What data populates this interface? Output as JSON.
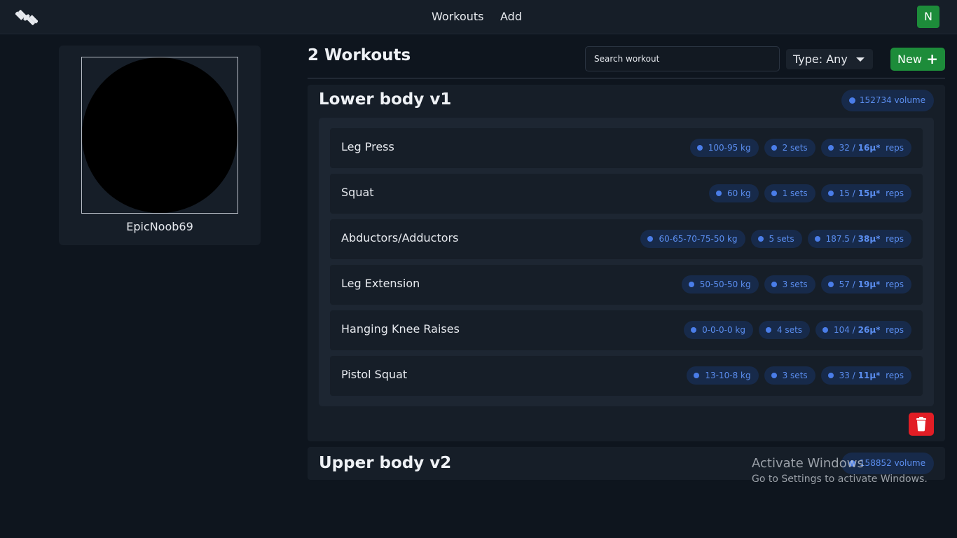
{
  "nav": {
    "links": [
      "Workouts",
      "Add"
    ],
    "avatar_letter": "N"
  },
  "profile": {
    "username": "EpicNoob69"
  },
  "header": {
    "count_title": "2 Workouts",
    "search_placeholder": "Search workout",
    "type_filter": "Type: Any",
    "new_label": "New"
  },
  "workouts": [
    {
      "title": "Lower body v1",
      "volume": "152734 volume",
      "exercises": [
        {
          "name": "Leg Press",
          "weight": "100-95 kg",
          "sets": "2 sets",
          "reps_total": "32 /",
          "reps_avg": "16μ*",
          "reps_unit": "reps"
        },
        {
          "name": "Squat",
          "weight": "60 kg",
          "sets": "1 sets",
          "reps_total": "15 /",
          "reps_avg": "15μ*",
          "reps_unit": "reps"
        },
        {
          "name": "Abductors/Adductors",
          "weight": "60-65-70-75-50 kg",
          "sets": "5 sets",
          "reps_total": "187.5 /",
          "reps_avg": "38μ*",
          "reps_unit": "reps"
        },
        {
          "name": "Leg Extension",
          "weight": "50-50-50 kg",
          "sets": "3 sets",
          "reps_total": "57 /",
          "reps_avg": "19μ*",
          "reps_unit": "reps"
        },
        {
          "name": "Hanging Knee Raises",
          "weight": "0-0-0-0 kg",
          "sets": "4 sets",
          "reps_total": "104 /",
          "reps_avg": "26μ*",
          "reps_unit": "reps"
        },
        {
          "name": "Pistol Squat",
          "weight": "13-10-8 kg",
          "sets": "3 sets",
          "reps_total": "33 /",
          "reps_avg": "11μ*",
          "reps_unit": "reps"
        }
      ]
    },
    {
      "title": "Upper body v2",
      "volume": "158852 volume"
    }
  ],
  "watermark": {
    "title": "Activate Windows",
    "subtitle": "Go to Settings to activate Windows."
  },
  "icons": {
    "logo": "dumbbell-logo-icon",
    "delete": "trash-icon",
    "plus": "plus-icon",
    "caret": "caret-down-icon"
  },
  "colors": {
    "background": "#0e151e",
    "card": "#161e28",
    "accent_green": "#1d8c3a",
    "pill_bg": "#172a4a",
    "pill_text": "#5b8ef0",
    "danger": "#e21d25"
  }
}
